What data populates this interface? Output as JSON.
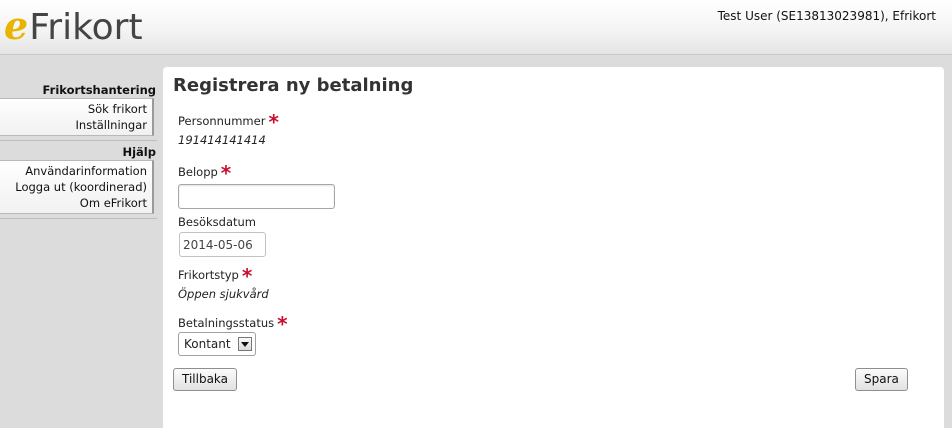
{
  "header": {
    "logo_e": "e",
    "logo_rest": "Frikort",
    "user_info": "Test User (SE13813023981), Efrikort"
  },
  "sidebar": {
    "sections": [
      {
        "heading": "Frikortshantering",
        "items": [
          "Sök frikort",
          "Inställningar"
        ]
      },
      {
        "heading": "Hjälp",
        "items": [
          "Användarinformation",
          "Logga ut (koordinerad)",
          "Om eFrikort"
        ]
      }
    ]
  },
  "form": {
    "title": "Registrera ny betalning",
    "required_marker": "*",
    "personnummer_label": "Personnummer",
    "personnummer_value": "191414141414",
    "belopp_label": "Belopp",
    "belopp_value": "",
    "besoksdatum_label": "Besöksdatum",
    "besoksdatum_value": "2014-05-06",
    "frikortstyp_label": "Frikortstyp",
    "frikortstyp_value": "Öppen sjukvård",
    "betalningsstatus_label": "Betalningsstatus",
    "betalningsstatus_value": "Kontant",
    "back_label": "Tillbaka",
    "save_label": "Spara"
  },
  "colors": {
    "accent_logo": "#e8b400",
    "required": "#c8102e",
    "background": "#dcdcdc"
  }
}
